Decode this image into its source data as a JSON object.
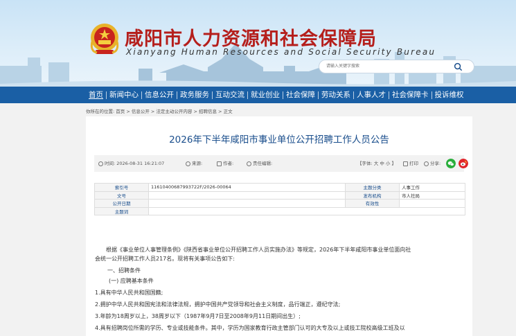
{
  "header": {
    "title": "咸阳市人力资源和社会保障局",
    "subtitle": "Xianyang Human Resources and Social Security Bureau",
    "search_placeholder": "请输入关键字搜索"
  },
  "nav": {
    "items": [
      {
        "label": "首页"
      },
      {
        "label": "新闻中心"
      },
      {
        "label": "信息公开"
      },
      {
        "label": "政务服务"
      },
      {
        "label": "互动交流"
      },
      {
        "label": "就业创业"
      },
      {
        "label": "社会保障"
      },
      {
        "label": "劳动关系"
      },
      {
        "label": "人事人才"
      },
      {
        "label": "社会保障卡"
      },
      {
        "label": "投诉维权"
      }
    ]
  },
  "breadcrumb": "你所在的位置: 首页 > 信息公开 > 法定主动公开内容 > 招聘信息 > 正文",
  "article": {
    "title": "2026年下半年咸阳市事业单位公开招聘工作人员公告",
    "meta": {
      "time": "时间: 2026-08-31 16:21:07",
      "source": "来源:",
      "author": "作者:",
      "editor": "责任编辑:",
      "font_size": "【字体: 大 中 小 】",
      "print": "打印",
      "share": "分享:"
    },
    "info": {
      "index_label": "索引号",
      "index_value": "11610400687993722F/2026-00064",
      "category_label": "主题分类",
      "category_value": "人事工作",
      "doc_no_label": "文号",
      "doc_no_value": "",
      "issuer_label": "发布机构",
      "issuer_value": "市人社局",
      "date_label": "公开日期",
      "date_value": "",
      "validity_label": "有效性",
      "validity_value": "",
      "keywords_label": "主题词",
      "keywords_value": ""
    },
    "body": {
      "p1a": "根据《事业单位人事管理条例》《陕西省事业单位公开招聘工作人员实施办法》等规定，2026年下半年咸阳市事业单位面向社",
      "p1b": "会统一公开招聘工作人员217名。现将有关事项公告如下:",
      "h1": "一、招聘条件",
      "h2": "(一) 应聘基本条件",
      "l1": "1.具有中华人民共和国国籍;",
      "l2": "2.拥护中华人民共和国宪法和法律法规，拥护中国共产党领导和社会主义制度，品行端正，遵纪守法;",
      "l3": "3.年龄为18周岁以上，38周岁以下（1987年9月7日至2008年9月11日期间出生）;",
      "l4": "4.具有招聘岗位所需的学历、专业或技能条件。其中，学历为国家教育行政主管部门认可的大专及以上或技工院校高级工班及以"
    }
  },
  "colors": {
    "nav_bg": "#1a5fa5",
    "title_red": "#b51f1c",
    "article_title": "#1a4e8c"
  }
}
